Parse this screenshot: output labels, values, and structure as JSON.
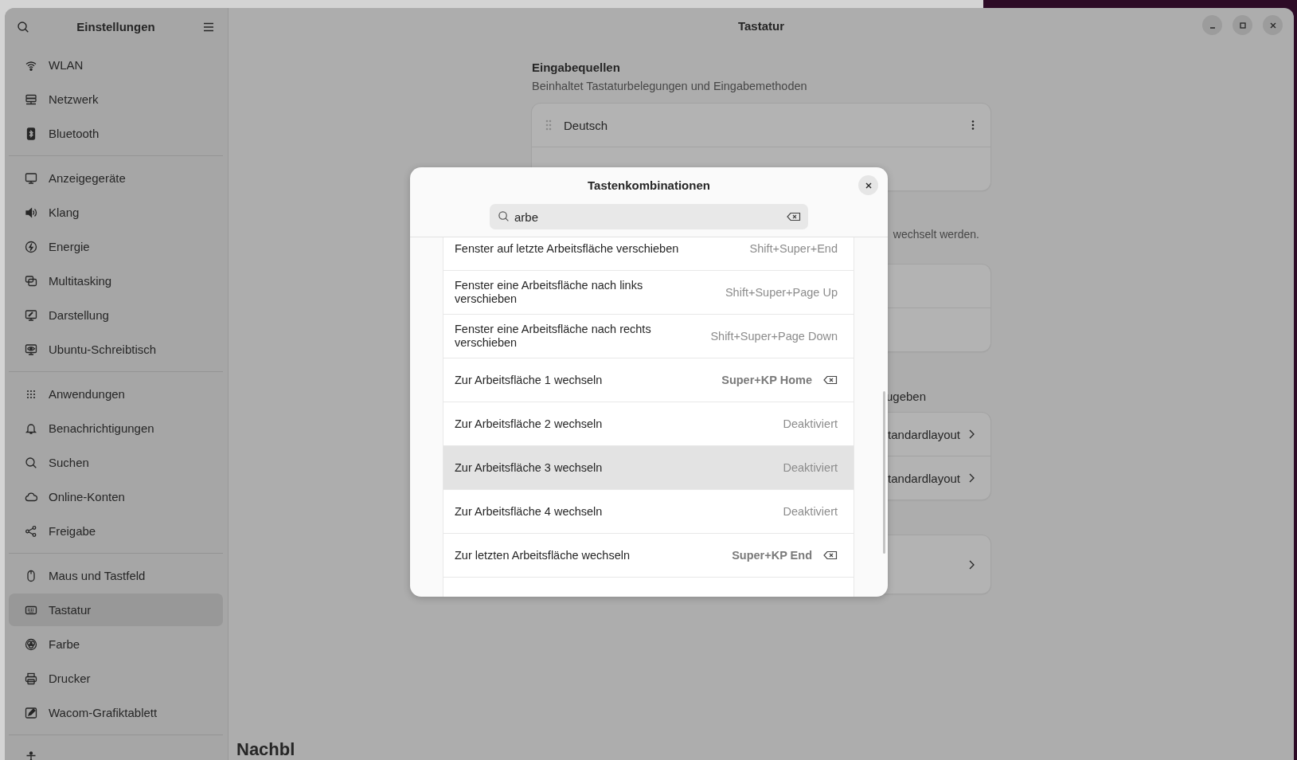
{
  "sidebar": {
    "title": "Einstellungen",
    "groups": [
      {
        "items": [
          {
            "label": "WLAN",
            "selected": false
          },
          {
            "label": "Netzwerk",
            "selected": false
          },
          {
            "label": "Bluetooth",
            "selected": false
          }
        ]
      },
      {
        "items": [
          {
            "label": "Anzeigegeräte",
            "selected": false
          },
          {
            "label": "Klang",
            "selected": false
          },
          {
            "label": "Energie",
            "selected": false
          },
          {
            "label": "Multitasking",
            "selected": false
          },
          {
            "label": "Darstellung",
            "selected": false
          },
          {
            "label": "Ubuntu-Schreibtisch",
            "selected": false
          }
        ]
      },
      {
        "items": [
          {
            "label": "Anwendungen",
            "selected": false
          },
          {
            "label": "Benachrichtigungen",
            "selected": false
          },
          {
            "label": "Suchen",
            "selected": false
          },
          {
            "label": "Online-Konten",
            "selected": false
          },
          {
            "label": "Freigabe",
            "selected": false
          }
        ]
      },
      {
        "items": [
          {
            "label": "Maus und Tastfeld",
            "selected": false
          },
          {
            "label": "Tastatur",
            "selected": true
          },
          {
            "label": "Farbe",
            "selected": false
          },
          {
            "label": "Drucker",
            "selected": false
          },
          {
            "label": "Wacom-Grafiktablett",
            "selected": false
          }
        ]
      }
    ]
  },
  "window": {
    "title": "Tastatur"
  },
  "content": {
    "input_sources": {
      "heading": "Eingabequellen",
      "subtitle": "Beinhaltet Tastaturbelegungen und Eingabemethoden",
      "sources": [
        {
          "name": "Deutsch"
        }
      ]
    },
    "switch_note": "wechselt werden.",
    "section_note": "ugeben",
    "layout_rows": [
      {
        "value": "tandardlayout"
      },
      {
        "value": "tandardlayout"
      }
    ],
    "bottom_heading": "Nachbl"
  },
  "dialog": {
    "title": "Tastenkombinationen",
    "search": {
      "value": "arbe"
    },
    "rows": [
      {
        "label": "Fenster auf letzte Arbeitsfläche verschieben",
        "shortcut": "Shift+Super+End",
        "custom": false,
        "highlighted": false
      },
      {
        "label": "Fenster eine Arbeitsfläche nach links verschieben",
        "shortcut": "Shift+Super+Page Up",
        "custom": false,
        "highlighted": false
      },
      {
        "label": "Fenster eine Arbeitsfläche nach rechts verschieben",
        "shortcut": "Shift+Super+Page Down",
        "custom": false,
        "highlighted": false
      },
      {
        "label": "Zur Arbeitsfläche 1 wechseln",
        "shortcut": "Super+KP Home",
        "custom": true,
        "highlighted": false
      },
      {
        "label": "Zur Arbeitsfläche 2 wechseln",
        "shortcut": "Deaktiviert",
        "custom": false,
        "highlighted": false
      },
      {
        "label": "Zur Arbeitsfläche 3 wechseln",
        "shortcut": "Deaktiviert",
        "custom": false,
        "highlighted": true
      },
      {
        "label": "Zur Arbeitsfläche 4 wechseln",
        "shortcut": "Deaktiviert",
        "custom": false,
        "highlighted": false
      },
      {
        "label": "Zur letzten Arbeitsfläche wechseln",
        "shortcut": "Super+KP End",
        "custom": true,
        "highlighted": false
      }
    ]
  }
}
